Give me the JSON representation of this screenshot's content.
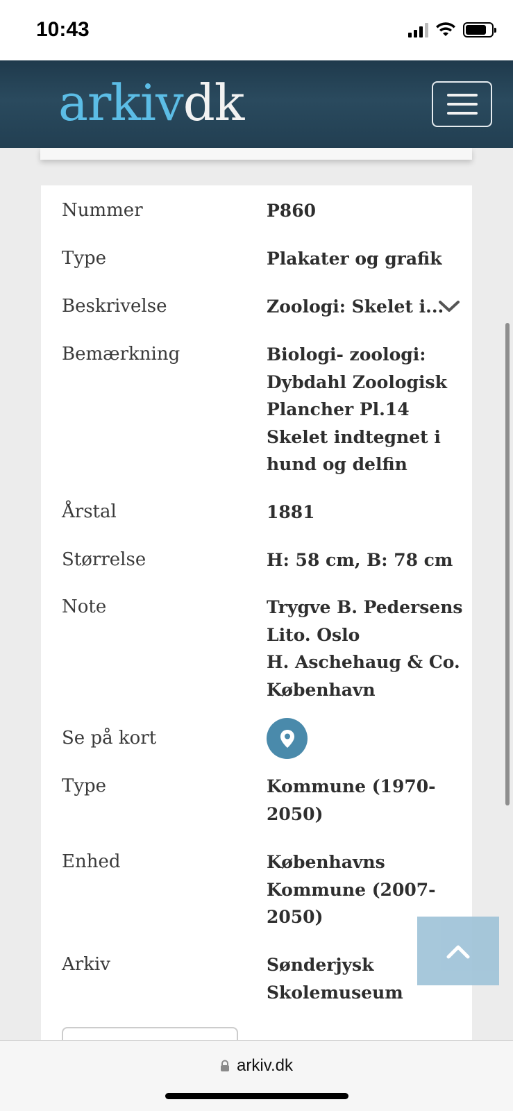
{
  "status_bar": {
    "time": "10:43"
  },
  "header": {
    "logo_part1": "arkiv",
    "logo_part2": "dk",
    "menu_icon": "hamburger-menu-icon"
  },
  "details": {
    "rows": [
      {
        "label": "Nummer",
        "value": "P860"
      },
      {
        "label": "Type",
        "value": "Plakater og grafik"
      },
      {
        "label": "Beskrivelse",
        "value": "Zoologi: Skelet i...",
        "icon": "chevron-down-icon"
      },
      {
        "label": "Bemærkning",
        "value": "Biologi- zoologi: Dybdahl Zoologisk Plancher Pl.14 Skelet indtegnet i hund og delfin"
      },
      {
        "label": "Årstal",
        "value": "1881"
      },
      {
        "label": "Størrelse",
        "value": "H: 58 cm, B: 78 cm"
      },
      {
        "label": "Note",
        "value_lines": [
          "Trygve B. Pedersens Lito. Oslo",
          "H. Aschehaug & Co. København"
        ]
      },
      {
        "label": "Se på kort",
        "icon": "map-pin-icon"
      },
      {
        "label": "Type",
        "value": "Kommune (1970-2050)"
      },
      {
        "label": "Enhed",
        "value": "Københavns Kommune (2007-2050)"
      },
      {
        "label": "Arkiv",
        "value": "Sønderjysk Skolemuseum"
      }
    ]
  },
  "back_to_top_icon": "chevron-up-icon",
  "browser": {
    "url": "arkiv.dk",
    "lock_icon": "lock-icon"
  },
  "colors": {
    "header_bg": "#223f52",
    "logo_accent": "#5cbde6",
    "map_button": "#4a8aab",
    "back_to_top": "#9fc3d8"
  }
}
